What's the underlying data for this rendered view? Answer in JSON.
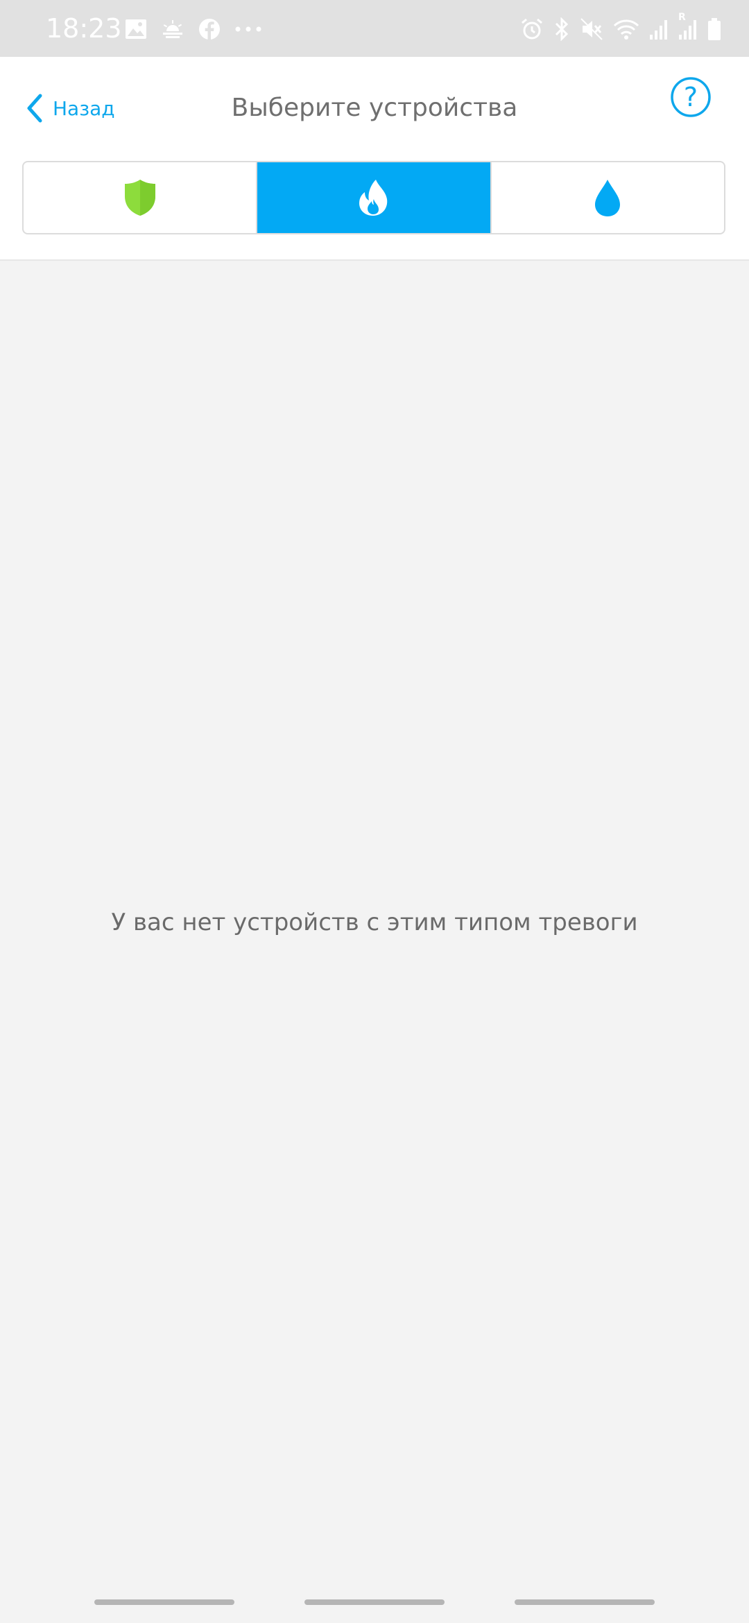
{
  "status_bar": {
    "time": "18:23",
    "left_icons": [
      "gallery-icon",
      "weather-icon",
      "facebook-icon",
      "more-dots-icon"
    ],
    "right_icons": [
      "alarm-icon",
      "bluetooth-icon",
      "mute-icon",
      "wifi-icon",
      "signal-icon",
      "signal-roaming-icon",
      "battery-icon"
    ],
    "roaming_label": "R"
  },
  "header": {
    "back_label": "Назад",
    "title": "Выберите устройства",
    "help_symbol": "?"
  },
  "segments": [
    {
      "id": "security",
      "icon": "shield-icon",
      "color": "#8ddc3c",
      "active": false
    },
    {
      "id": "fire",
      "icon": "flame-icon",
      "color": "#ffffff",
      "active": true
    },
    {
      "id": "water",
      "icon": "water-drop-icon",
      "color": "#03a9f4",
      "active": false
    }
  ],
  "colors": {
    "accent": "#03a9f4",
    "link": "#0ea7ec",
    "background": "#f3f3f3",
    "shield": "#8ddc3c"
  },
  "content": {
    "empty_message": "У вас нет устройств с этим типом тревоги"
  }
}
